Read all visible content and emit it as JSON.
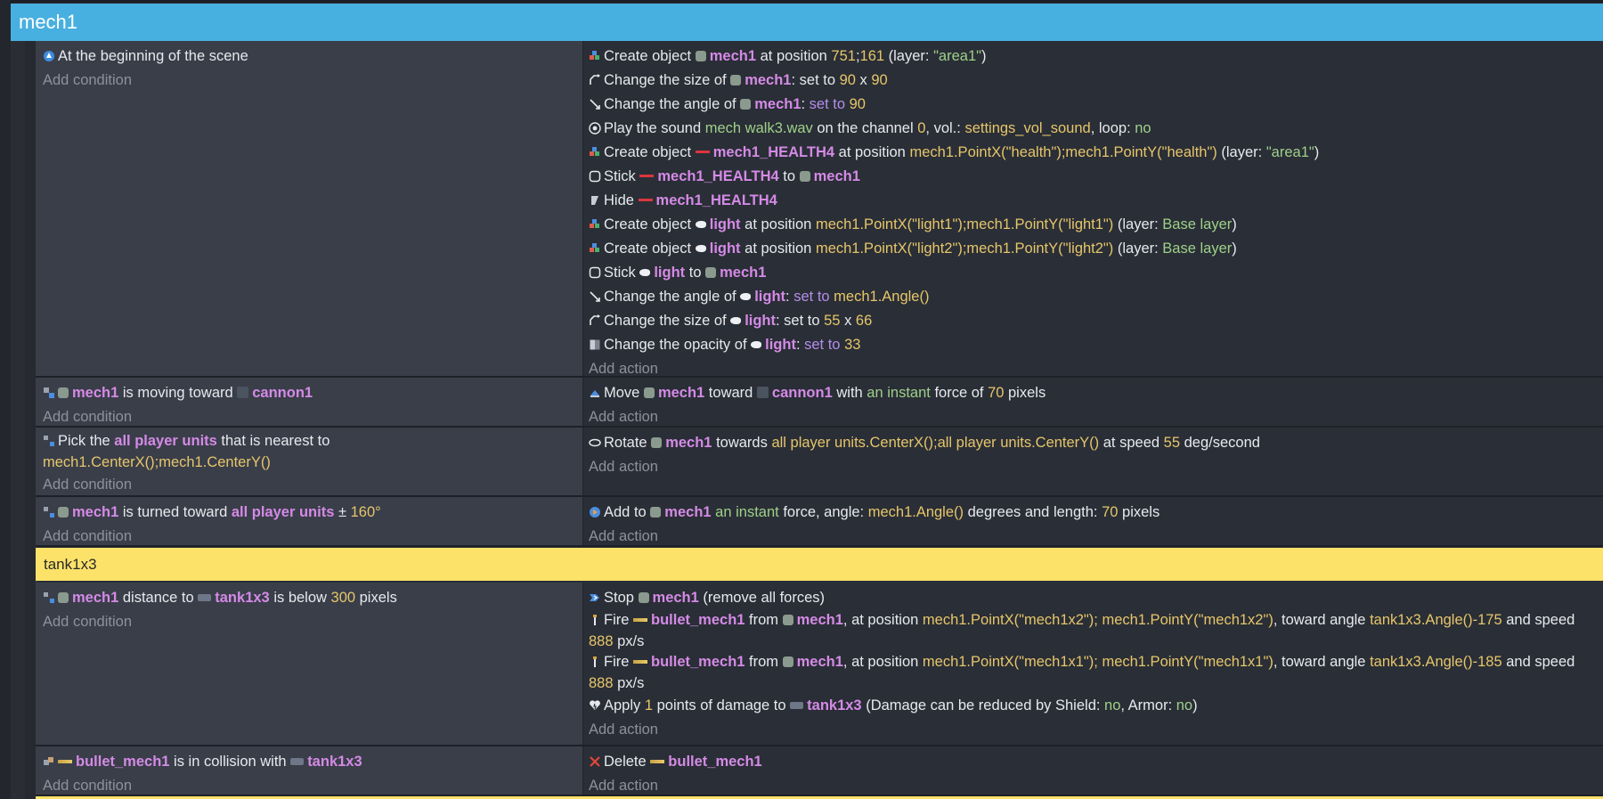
{
  "header": {
    "title": "mech1"
  },
  "group": {
    "title": "tank1x3"
  },
  "labels": {
    "add_condition": "Add condition",
    "add_action": "Add action"
  },
  "colors": {
    "header": "#48b0e0",
    "group": "#fde26a",
    "object": "#d48ae6",
    "number": "#e6c66b",
    "string": "#9ed08a"
  },
  "events": [
    {
      "conditions": [
        {
          "icon": "scene-start-icon",
          "text": "At the beginning of the scene"
        }
      ],
      "actions": [
        {
          "icon": "create-object-icon",
          "parts": [
            "Create object ",
            "mech1",
            " at position ",
            "751",
            ";",
            "161",
            " (layer: ",
            "\"area1\"",
            ")"
          ]
        },
        {
          "icon": "resize-icon",
          "parts": [
            "Change the size of ",
            "mech1",
            ": set to ",
            "90",
            " x ",
            "90"
          ]
        },
        {
          "icon": "angle-icon",
          "parts": [
            "Change the angle of ",
            "mech1",
            ": ",
            "set to",
            " ",
            "90"
          ]
        },
        {
          "icon": "sound-icon",
          "parts": [
            "Play the sound ",
            "mech walk3.wav",
            " on the channel ",
            "0",
            ", vol.: ",
            "settings_vol_sound",
            ", loop: ",
            "no"
          ]
        },
        {
          "icon": "create-object-icon",
          "parts": [
            "Create object ",
            "mech1_HEALTH4",
            " at position ",
            "mech1.PointX(\"health\");mech1.PointY(\"health\")",
            " (layer: ",
            "\"area1\"",
            ")"
          ]
        },
        {
          "icon": "stick-icon",
          "parts": [
            "Stick ",
            "mech1_HEALTH4",
            " to ",
            "mech1"
          ]
        },
        {
          "icon": "hide-icon",
          "parts": [
            "Hide ",
            "mech1_HEALTH4"
          ]
        },
        {
          "icon": "create-object-icon",
          "parts": [
            "Create object ",
            "light",
            " at position ",
            "mech1.PointX(\"light1\");mech1.PointY(\"light1\")",
            " (layer: ",
            "Base layer",
            ")"
          ]
        },
        {
          "icon": "create-object-icon",
          "parts": [
            "Create object ",
            "light",
            " at position ",
            "mech1.PointX(\"light2\");mech1.PointY(\"light2\")",
            " (layer: ",
            "Base layer",
            ")"
          ]
        },
        {
          "icon": "stick-icon",
          "parts": [
            "Stick ",
            "light",
            " to ",
            "mech1"
          ]
        },
        {
          "icon": "angle-icon",
          "parts": [
            "Change the angle of ",
            "light",
            ": ",
            "set to",
            " ",
            "mech1.Angle()"
          ]
        },
        {
          "icon": "resize-icon",
          "parts": [
            "Change the size of ",
            "light",
            ": set to ",
            "55",
            " x ",
            "66"
          ]
        },
        {
          "icon": "opacity-icon",
          "parts": [
            "Change the opacity of ",
            "light",
            ": ",
            "set to",
            " ",
            "33"
          ]
        }
      ]
    },
    {
      "conditions": [
        {
          "icon": "moving-toward-icon",
          "parts": [
            "mech1",
            " is moving toward ",
            "cannon1"
          ]
        }
      ],
      "actions": [
        {
          "icon": "move-icon",
          "parts": [
            "Move ",
            "mech1",
            " toward ",
            "cannon1",
            " with ",
            "an instant",
            " force of ",
            "70",
            " pixels"
          ]
        }
      ]
    },
    {
      "conditions": [
        {
          "icon": "pick-nearest-icon",
          "parts": [
            "Pick the ",
            "all player units",
            " that is nearest to ",
            "mech1.CenterX();mech1.CenterY()"
          ]
        }
      ],
      "actions": [
        {
          "icon": "rotate-icon",
          "parts": [
            "Rotate ",
            "mech1",
            " towards ",
            "all player units.CenterX();all player units.CenterY()",
            " at speed ",
            "55",
            " deg/second"
          ]
        }
      ]
    },
    {
      "conditions": [
        {
          "icon": "turned-toward-icon",
          "parts": [
            "mech1",
            " is turned toward ",
            "all player units",
            " ± ",
            "160°"
          ]
        }
      ],
      "actions": [
        {
          "icon": "force-icon",
          "parts": [
            "Add to ",
            "mech1",
            " ",
            "an instant",
            " force, angle: ",
            "mech1.Angle()",
            " degrees and length: ",
            "70",
            " pixels"
          ]
        }
      ]
    },
    {
      "conditions": [
        {
          "icon": "distance-icon",
          "parts": [
            "mech1",
            " distance to ",
            "tank1x3",
            " is below ",
            "300",
            " pixels"
          ]
        }
      ],
      "actions": [
        {
          "icon": "stop-icon",
          "parts": [
            "Stop ",
            "mech1",
            " (remove all forces)"
          ]
        },
        {
          "icon": "fire-icon",
          "parts": [
            "Fire ",
            "bullet_mech1",
            " from ",
            "mech1",
            ", at position ",
            "mech1.PointX(\"mech1x2\"); mech1.PointY(\"mech1x2\")",
            ", toward angle ",
            "tank1x3.Angle()-175",
            " and speed ",
            "888",
            " px/s"
          ]
        },
        {
          "icon": "fire-icon",
          "parts": [
            "Fire ",
            "bullet_mech1",
            " from ",
            "mech1",
            ", at position ",
            "mech1.PointX(\"mech1x1\"); mech1.PointY(\"mech1x1\")",
            ", toward angle ",
            "tank1x3.Angle()-185",
            " and speed ",
            "888",
            " px/s"
          ]
        },
        {
          "icon": "damage-icon",
          "parts": [
            "Apply ",
            "1",
            " points of damage to ",
            "tank1x3",
            " (Damage can be reduced by Shield: ",
            "no",
            ", Armor: ",
            "no",
            ")"
          ]
        }
      ]
    },
    {
      "conditions": [
        {
          "icon": "collision-icon",
          "parts": [
            "bullet_mech1",
            " is in collision with ",
            "tank1x3"
          ]
        }
      ],
      "actions": [
        {
          "icon": "delete-icon",
          "parts": [
            "Delete ",
            "bullet_mech1"
          ]
        }
      ]
    }
  ]
}
